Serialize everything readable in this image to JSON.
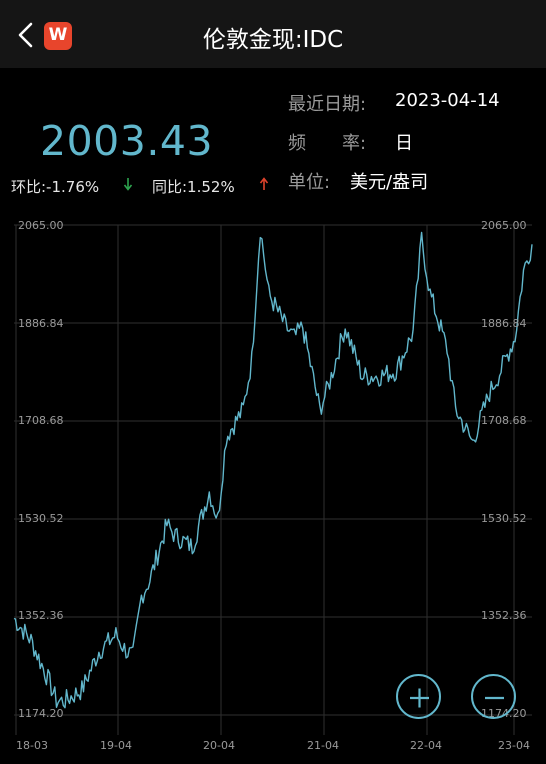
{
  "header": {
    "title": "伦敦金现:IDC",
    "back_icon": "chevron-left-icon",
    "logo_text": "W"
  },
  "summary": {
    "price": "2003.43",
    "mom_label": "环比:-1.76%",
    "yoy_label": "同比:1.52%",
    "date_label": "最近日期:",
    "date_value": "2023-04-14",
    "freq_label": "频　　率:",
    "freq_value": "日",
    "unit_label": "单位:",
    "unit_value": "美元/盎司"
  },
  "colors": {
    "line": "#62b7cc",
    "down": "#2ea44f",
    "up": "#e0432c",
    "grid": "#2f2f2f"
  },
  "controls": {
    "zoom_in": "zoom-in-icon",
    "zoom_out": "zoom-out-icon"
  },
  "chart_data": {
    "type": "line",
    "y_ticks": [
      "2065.00",
      "1886.84",
      "1708.68",
      "1530.52",
      "1352.36",
      "1174.20"
    ],
    "x_ticks": [
      "18-03",
      "19-04",
      "20-04",
      "21-04",
      "22-04",
      "23-04"
    ],
    "ylim": [
      1174.2,
      2065.0
    ],
    "x": [
      "2018-03",
      "2018-05",
      "2018-07",
      "2018-08",
      "2018-09",
      "2018-11",
      "2019-01",
      "2019-03",
      "2019-04",
      "2019-05",
      "2019-06",
      "2019-07",
      "2019-09",
      "2019-10",
      "2019-12",
      "2020-02",
      "2020-03",
      "2020-04",
      "2020-06",
      "2020-07",
      "2020-08",
      "2020-09",
      "2020-11",
      "2020-12",
      "2021-01",
      "2021-03",
      "2021-04",
      "2021-06",
      "2021-08",
      "2021-10",
      "2021-12",
      "2022-02",
      "2022-03",
      "2022-04",
      "2022-06",
      "2022-07",
      "2022-09",
      "2022-11",
      "2022-12",
      "2023-02",
      "2023-03",
      "2023-04"
    ],
    "values": [
      1350,
      1310,
      1240,
      1200,
      1200,
      1220,
      1290,
      1320,
      1295,
      1280,
      1390,
      1420,
      1520,
      1500,
      1480,
      1580,
      1530,
      1680,
      1730,
      1820,
      2060,
      1940,
      1880,
      1860,
      1880,
      1730,
      1770,
      1880,
      1790,
      1790,
      1800,
      1870,
      2040,
      1940,
      1840,
      1730,
      1670,
      1760,
      1790,
      1860,
      1980,
      2030
    ]
  }
}
